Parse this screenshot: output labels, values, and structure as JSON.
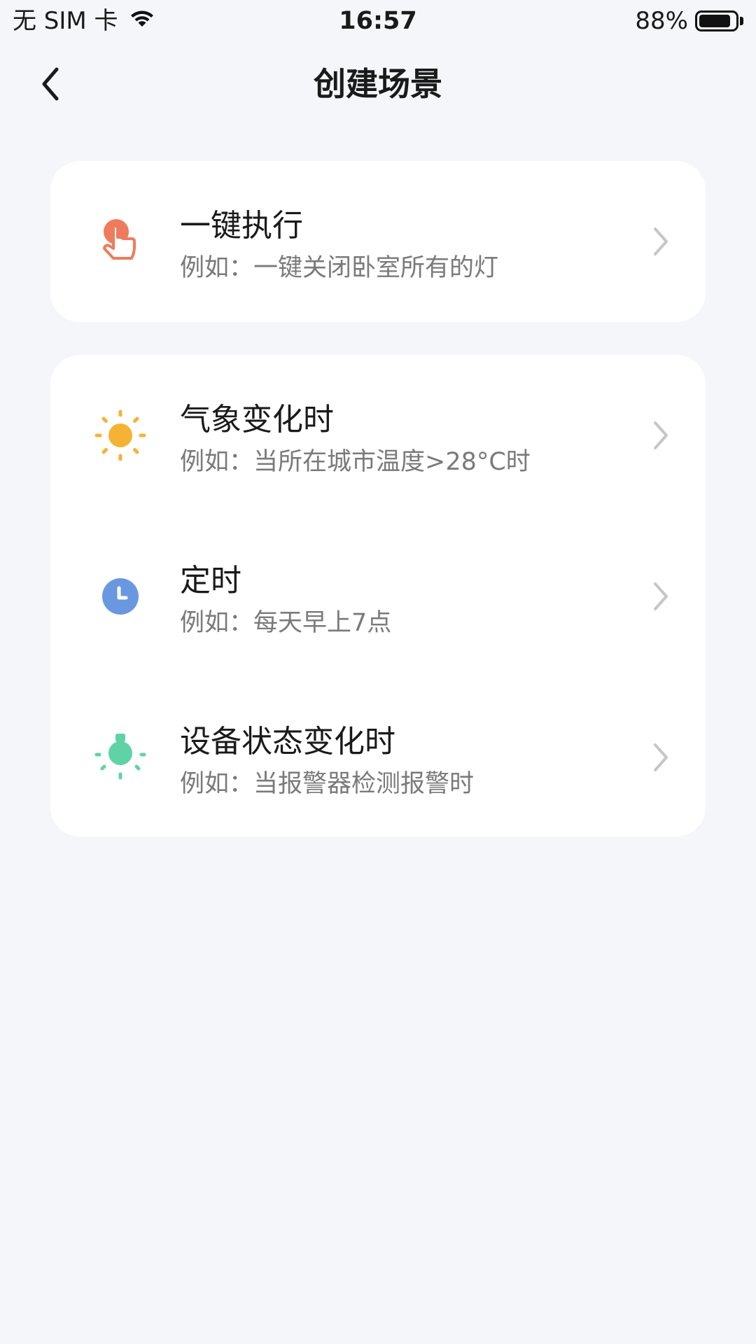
{
  "status_bar": {
    "carrier": "无 SIM 卡",
    "time": "16:57",
    "battery_percent_text": "88%",
    "battery_level": 0.88
  },
  "nav": {
    "title": "创建场景",
    "back_icon": "chevron-left-icon"
  },
  "groups": [
    {
      "items": [
        {
          "title": "一键执行",
          "desc": "例如：一键关闭卧室所有的灯",
          "icon": "tap-hand-icon",
          "icon_color": "#ee7c5c"
        }
      ]
    },
    {
      "items": [
        {
          "title": "气象变化时",
          "desc": "例如：当所在城市温度>28°C时",
          "icon": "sun-icon",
          "icon_color": "#f5b335"
        },
        {
          "title": "定时",
          "desc": "例如：每天早上7点",
          "icon": "clock-icon",
          "icon_color": "#6a98e0"
        },
        {
          "title": "设备状态变化时",
          "desc": "例如：当报警器检测报警时",
          "icon": "lightbulb-icon",
          "icon_color": "#5fd3a6"
        }
      ]
    }
  ]
}
